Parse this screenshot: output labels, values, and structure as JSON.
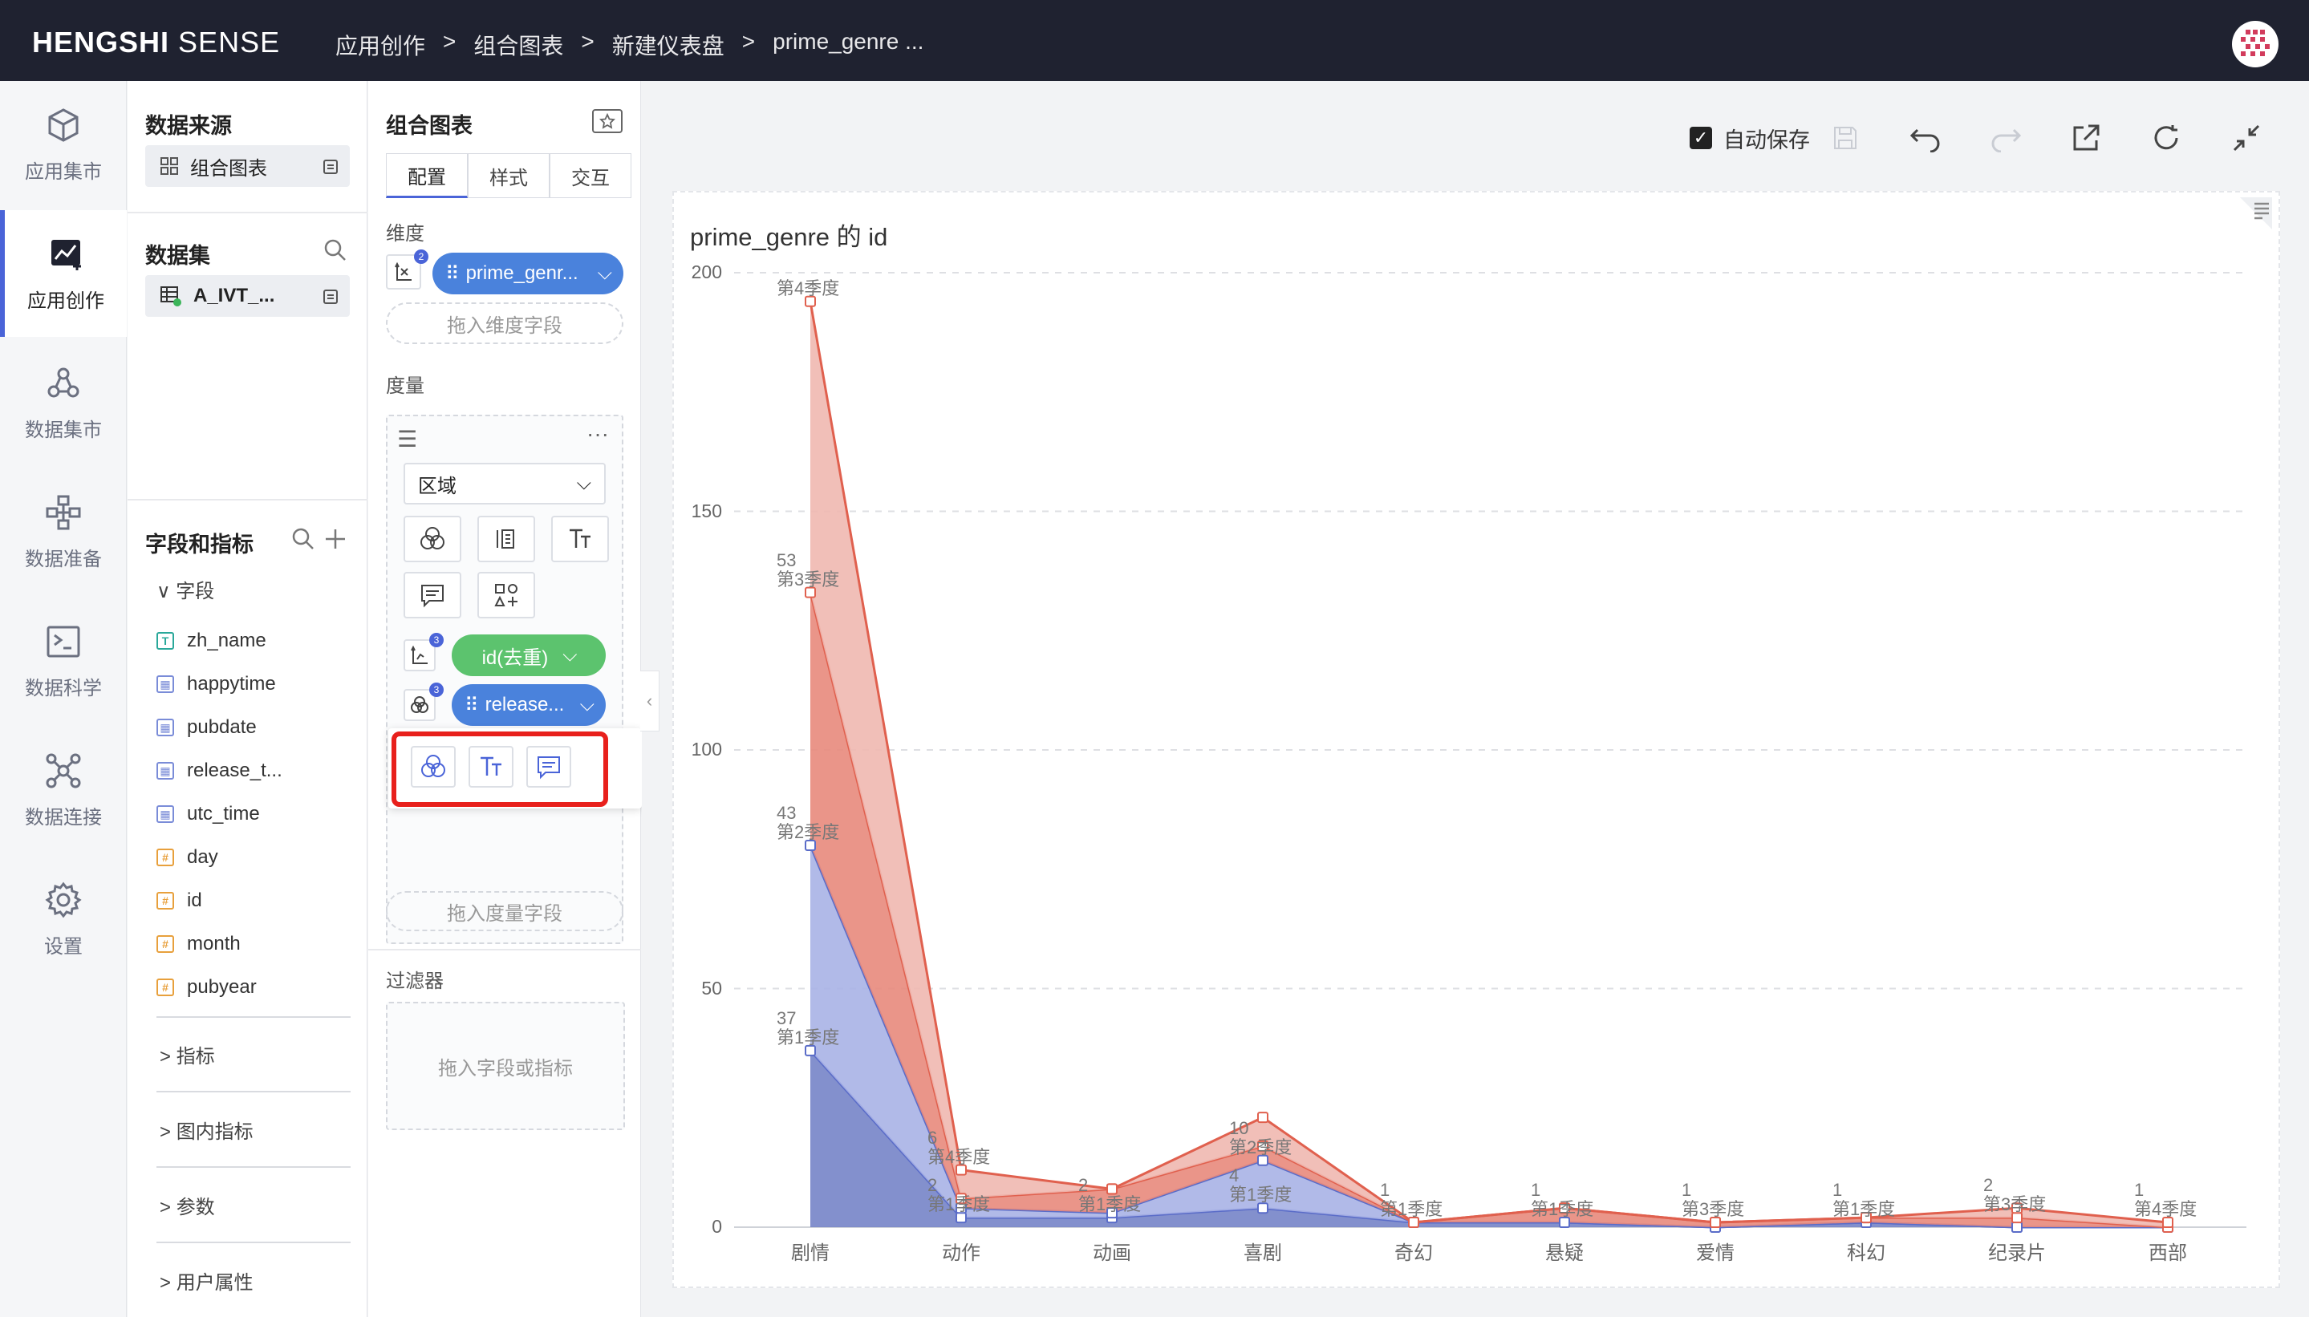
{
  "brand": {
    "name_bold": "HENGSHI",
    "name_light": "SENSE"
  },
  "breadcrumb": [
    "应用创作",
    ">",
    "组合图表",
    ">",
    "新建仪表盘",
    ">",
    "prime_genre ..."
  ],
  "leftnav": [
    {
      "label": "应用集市",
      "icon": "cube-icon",
      "active": false
    },
    {
      "label": "应用创作",
      "icon": "chart-create-icon",
      "active": true
    },
    {
      "label": "数据集市",
      "icon": "data-mart-icon",
      "active": false
    },
    {
      "label": "数据准备",
      "icon": "data-prep-icon",
      "active": false
    },
    {
      "label": "数据科学",
      "icon": "terminal-icon",
      "active": false
    },
    {
      "label": "数据连接",
      "icon": "connect-icon",
      "active": false
    },
    {
      "label": "设置",
      "icon": "gear-icon",
      "active": false
    }
  ],
  "datasource": {
    "title": "数据来源",
    "item": "组合图表"
  },
  "dataset": {
    "title": "数据集",
    "item": "A_IVT_..."
  },
  "fields": {
    "title": "字段和指标",
    "group_label": "字段",
    "items": [
      {
        "name": "zh_name",
        "type": "T"
      },
      {
        "name": "happytime",
        "type": "D"
      },
      {
        "name": "pubdate",
        "type": "D"
      },
      {
        "name": "release_t...",
        "type": "D"
      },
      {
        "name": "utc_time",
        "type": "D"
      },
      {
        "name": "day",
        "type": "#"
      },
      {
        "name": "id",
        "type": "#"
      },
      {
        "name": "month",
        "type": "#"
      },
      {
        "name": "pubyear",
        "type": "#"
      }
    ],
    "sections": [
      "指标",
      "图内指标",
      "参数",
      "用户属性"
    ]
  },
  "config": {
    "title": "组合图表",
    "tabs": [
      "配置",
      "样式",
      "交互"
    ],
    "dimension_label": "维度",
    "dimension_pill": "prime_genr...",
    "dimension_drop": "拖入维度字段",
    "measure_label": "度量",
    "chart_type": "区域",
    "measure_pill": "id(去重)",
    "color_pill": "release...",
    "measure_drop": "拖入度量字段",
    "filter_label": "过滤器",
    "filter_drop": "拖入字段或指标",
    "badges": [
      "2",
      "3",
      "3"
    ]
  },
  "toolbar": {
    "autosave_label": "自动保存",
    "autosave_checked": true
  },
  "chart_data": {
    "type": "area",
    "title": "prime_genre 的 id",
    "categories": [
      "剧情",
      "动作",
      "动画",
      "喜剧",
      "奇幻",
      "悬疑",
      "爱情",
      "科幻",
      "纪录片",
      "西部"
    ],
    "stacked": true,
    "ylim": [
      0,
      200
    ],
    "yticks": [
      0,
      50,
      100,
      150,
      200
    ],
    "series": [
      {
        "name": "第1季度",
        "values": [
          37,
          2,
          2,
          4,
          1,
          1,
          0,
          1,
          0,
          0
        ],
        "color": "#7584c8"
      },
      {
        "name": "第2季度",
        "values": [
          43,
          2,
          1,
          10,
          0,
          0,
          0,
          0,
          0,
          0
        ],
        "color": "#a9b3e6"
      },
      {
        "name": "第3季度",
        "values": [
          53,
          2,
          5,
          3,
          0,
          3,
          1,
          1,
          2,
          0
        ],
        "color": "#e88a7c"
      },
      {
        "name": "第4季度",
        "values": [
          61,
          6,
          0,
          6,
          0,
          0,
          0,
          0,
          2,
          1
        ],
        "color": "#f0b8b0"
      }
    ],
    "labels": [
      {
        "series": "第4季度",
        "cat": 0,
        "value": "",
        "text": "第4季度"
      },
      {
        "series": "第3季度",
        "cat": 0,
        "value": "53",
        "text": "第3季度"
      },
      {
        "series": "第2季度",
        "cat": 0,
        "value": "43",
        "text": "第2季度"
      },
      {
        "series": "第1季度",
        "cat": 0,
        "value": "37",
        "text": "第1季度"
      },
      {
        "series": "第4季度",
        "cat": 1,
        "value": "6",
        "text": "第4季度"
      },
      {
        "series": "第1季度",
        "cat": 1,
        "value": "2",
        "text": "第1季度"
      },
      {
        "series": "第1季度",
        "cat": 2,
        "value": "2",
        "text": "第1季度"
      },
      {
        "series": "第2季度",
        "cat": 3,
        "value": "10",
        "text": "第2季度"
      },
      {
        "series": "第1季度",
        "cat": 3,
        "value": "4",
        "text": "第1季度"
      },
      {
        "series": "第1季度",
        "cat": 4,
        "value": "1",
        "text": "第1季度"
      },
      {
        "series": "第1季度",
        "cat": 5,
        "value": "1",
        "text": "第1季度"
      },
      {
        "series": "第3季度",
        "cat": 6,
        "value": "1",
        "text": "第3季度"
      },
      {
        "series": "第1季度",
        "cat": 7,
        "value": "1",
        "text": "第1季度"
      },
      {
        "series": "第3季度",
        "cat": 8,
        "value": "2",
        "text": "第3季度"
      },
      {
        "series": "第4季度",
        "cat": 9,
        "value": "1",
        "text": "第4季度"
      }
    ]
  }
}
